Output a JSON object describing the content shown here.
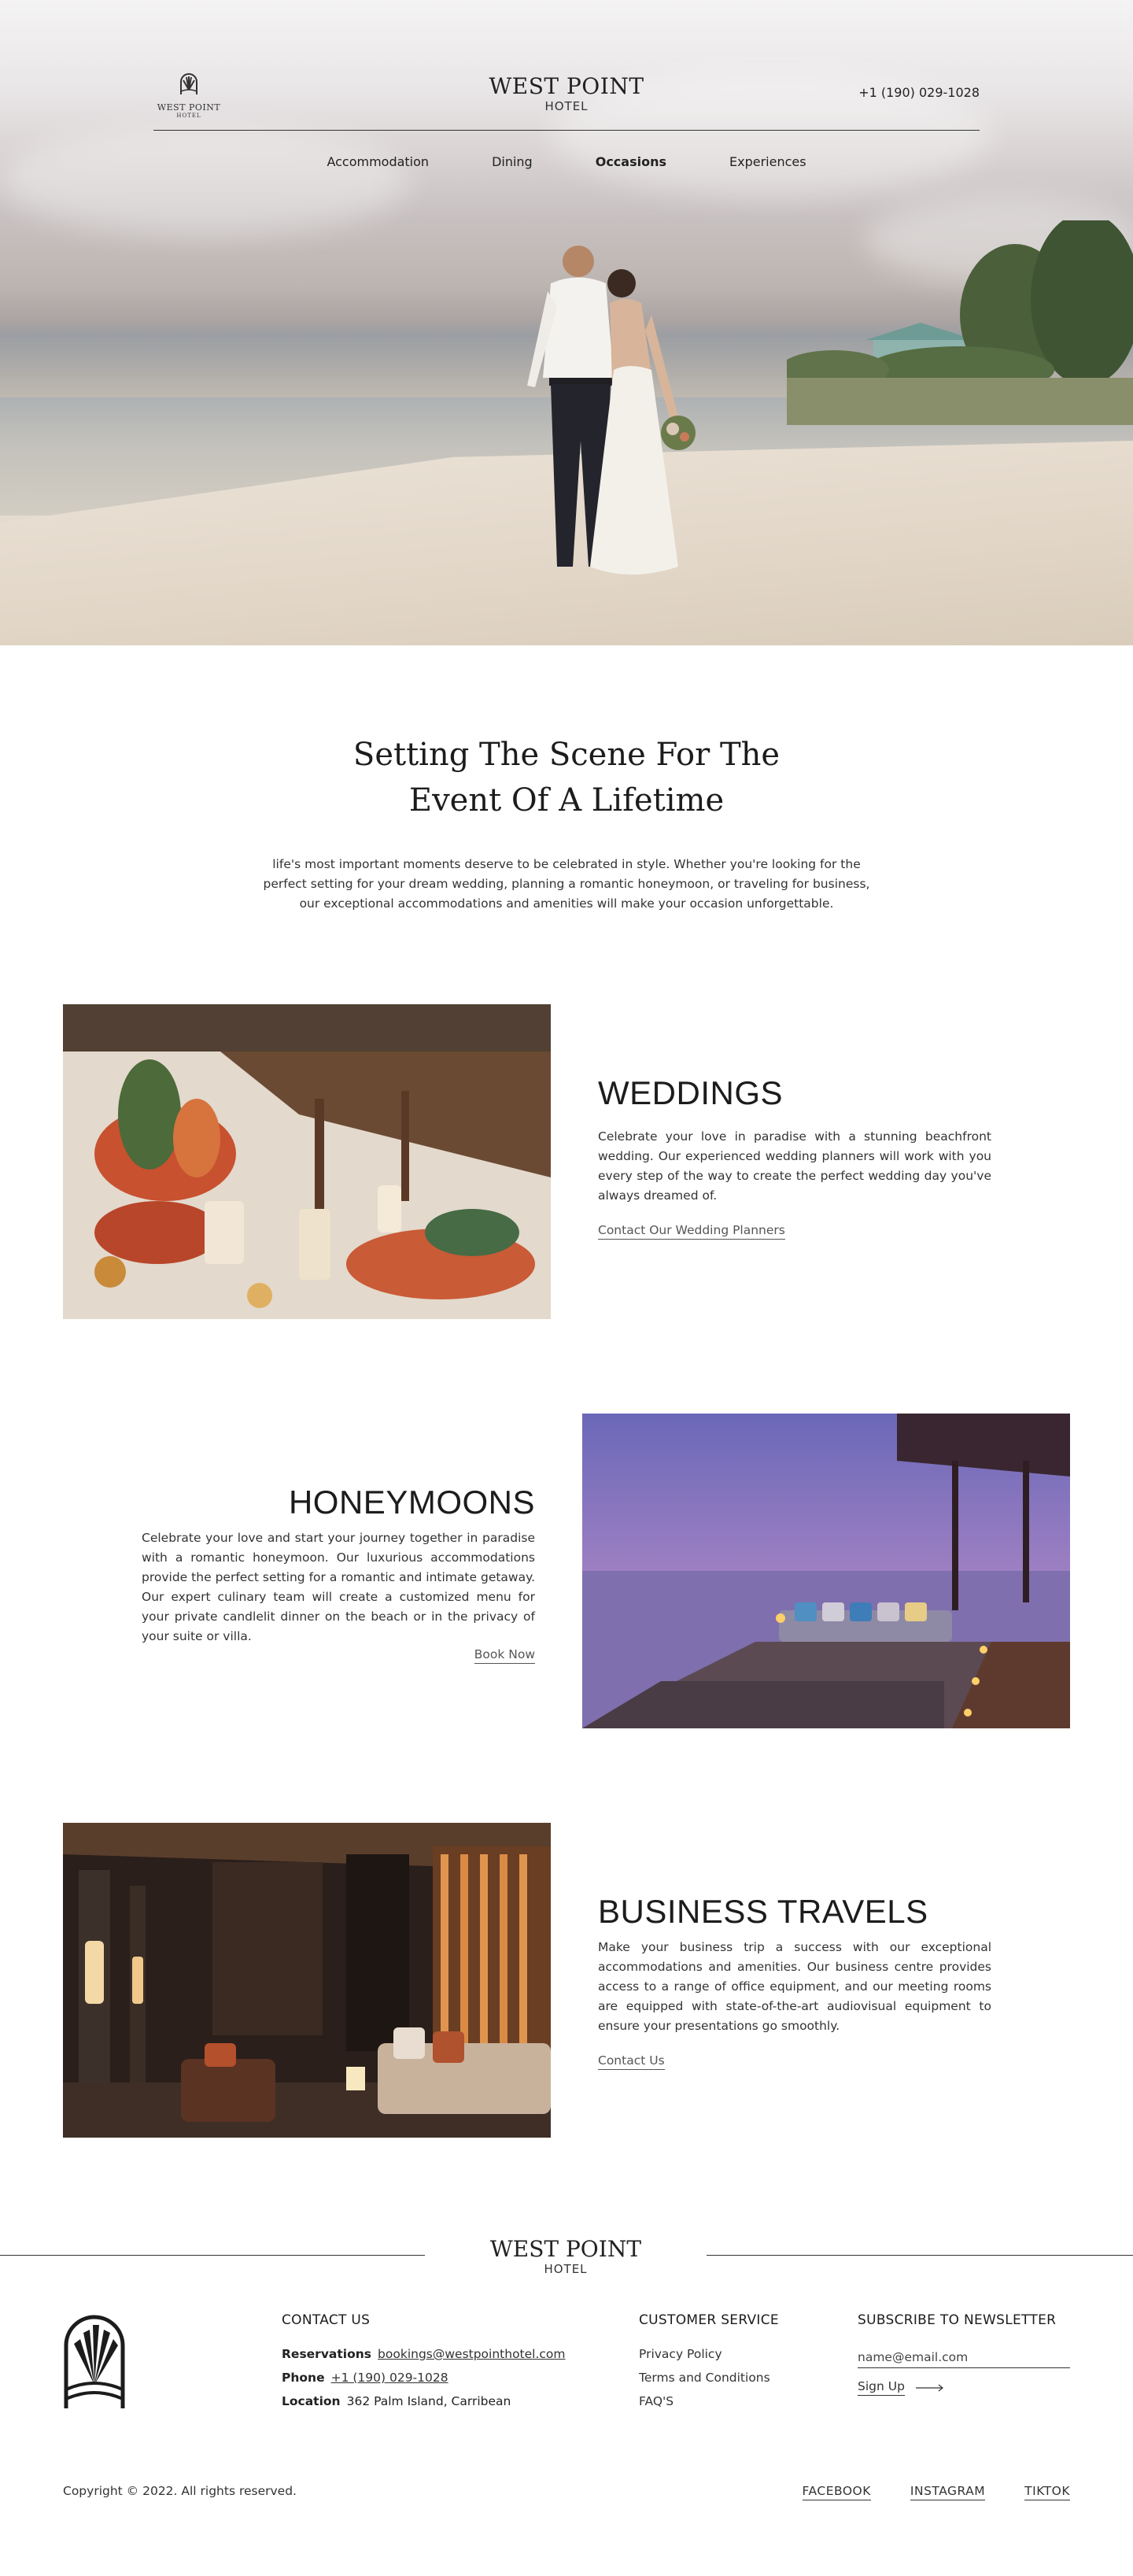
{
  "header": {
    "logo_name": "WEST POINT",
    "logo_sub": "HOTEL",
    "brand_name": "WEST POINT",
    "brand_sub": "HOTEL",
    "phone": "+1 (190) 029-1028",
    "nav": [
      {
        "label": "Accommodation",
        "active": false
      },
      {
        "label": "Dining",
        "active": false
      },
      {
        "label": "Occasions",
        "active": true
      },
      {
        "label": "Experiences",
        "active": false
      }
    ]
  },
  "intro": {
    "title_line1": "Setting The Scene For The",
    "title_line2": "Event Of A Lifetime",
    "text": "life's most important moments deserve to be celebrated in style. Whether you're looking for the perfect setting for your dream wedding, planning a romantic honeymoon, or traveling for business, our exceptional accommodations and amenities will make your occasion unforgettable."
  },
  "weddings": {
    "title": "WEDDINGS",
    "text": "Celebrate your love in paradise with a stunning beachfront wedding. Our experienced wedding planners will work with you every step of the way to create the perfect wedding day you've always dreamed of.",
    "link": "Contact Our Wedding Planners"
  },
  "honeymoons": {
    "title": "HONEYMOONS",
    "text": "Celebrate your love and start your journey together in paradise with a romantic honeymoon. Our luxurious accommodations provide the perfect setting for a romantic and intimate getaway. Our expert culinary team will create a customized menu for your private candlelit dinner on the beach or in the privacy of your suite or villa.",
    "link": "Book Now"
  },
  "business": {
    "title": "BUSINESS TRAVELS",
    "text": "Make your business trip a success with our exceptional accommodations and amenities. Our business centre provides access to a range of office equipment, and our meeting rooms are equipped with state-of-the-art audiovisual equipment to ensure your presentations go smoothly.",
    "link": "Contact Us"
  },
  "footer": {
    "brand_name": "WEST POINT",
    "brand_sub": "HOTEL",
    "contact": {
      "title": "CONTACT US",
      "reservations_label": "Reservations",
      "reservations_value": "bookings@westpointhotel.com",
      "phone_label": "Phone",
      "phone_value": "+1 (190) 029-1028",
      "location_label": "Location",
      "location_value": "362 Palm Island, Carribean"
    },
    "service": {
      "title": "CUSTOMER SERVICE",
      "links": [
        "Privacy Policy",
        "Terms and Conditions",
        "FAQ'S"
      ]
    },
    "newsletter": {
      "title": "SUBSCRIBE TO NEWSLETTER",
      "placeholder": "name@email.com",
      "button": "Sign Up"
    },
    "copyright": "Copyright © 2022.  All rights reserved.",
    "socials": [
      "FACEBOOK",
      "INSTAGRAM",
      "TIKTOK"
    ]
  },
  "icons": {
    "hotel_logo": "sunburst-arch-icon",
    "signup_arrow": "arrow-right-icon"
  }
}
